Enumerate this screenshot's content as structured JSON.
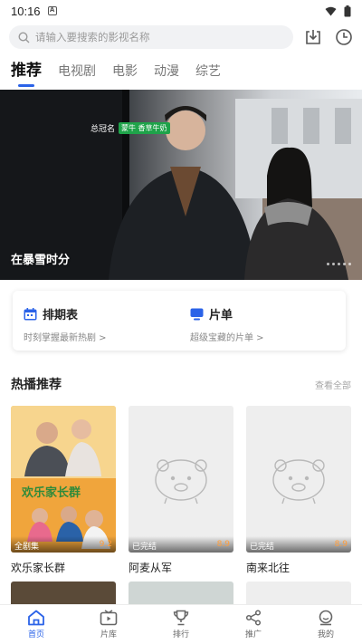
{
  "status_bar": {
    "time": "10:16",
    "notif": "A"
  },
  "search": {
    "placeholder": "请输入要搜索的影视名称"
  },
  "tabs": [
    {
      "label": "推荐",
      "active": true
    },
    {
      "label": "电视剧"
    },
    {
      "label": "电影"
    },
    {
      "label": "动漫"
    },
    {
      "label": "综艺"
    }
  ],
  "banner": {
    "title": "在暴雪时分",
    "sponsor_label": "总冠名",
    "sponsor_brand": "蒙牛 香草牛奶"
  },
  "shortcuts": [
    {
      "title": "排期表",
      "subtitle": "时刻掌握最新热剧 >",
      "icon": "calendar-icon"
    },
    {
      "title": "片单",
      "subtitle": "超级宝藏的片单 >",
      "icon": "playlist-icon"
    }
  ],
  "section": {
    "title": "热播推荐",
    "more": "查看全部"
  },
  "items": [
    {
      "title": "欢乐家长群",
      "status": "全剧集",
      "score": "9.2",
      "has_poster": true
    },
    {
      "title": "阿麦从军",
      "status": "已完结",
      "score": "8.9",
      "has_poster": false
    },
    {
      "title": "南来北往",
      "status": "已完结",
      "score": "8.9",
      "has_poster": false
    }
  ],
  "bottom_nav": [
    {
      "label": "首页",
      "icon": "home-icon",
      "active": true
    },
    {
      "label": "片库",
      "icon": "library-icon"
    },
    {
      "label": "排行",
      "icon": "trophy-icon"
    },
    {
      "label": "推广",
      "icon": "share-icon"
    },
    {
      "label": "我的",
      "icon": "profile-icon"
    }
  ],
  "colors": {
    "accent": "#2b63e8",
    "score": "#ff9d3b"
  }
}
